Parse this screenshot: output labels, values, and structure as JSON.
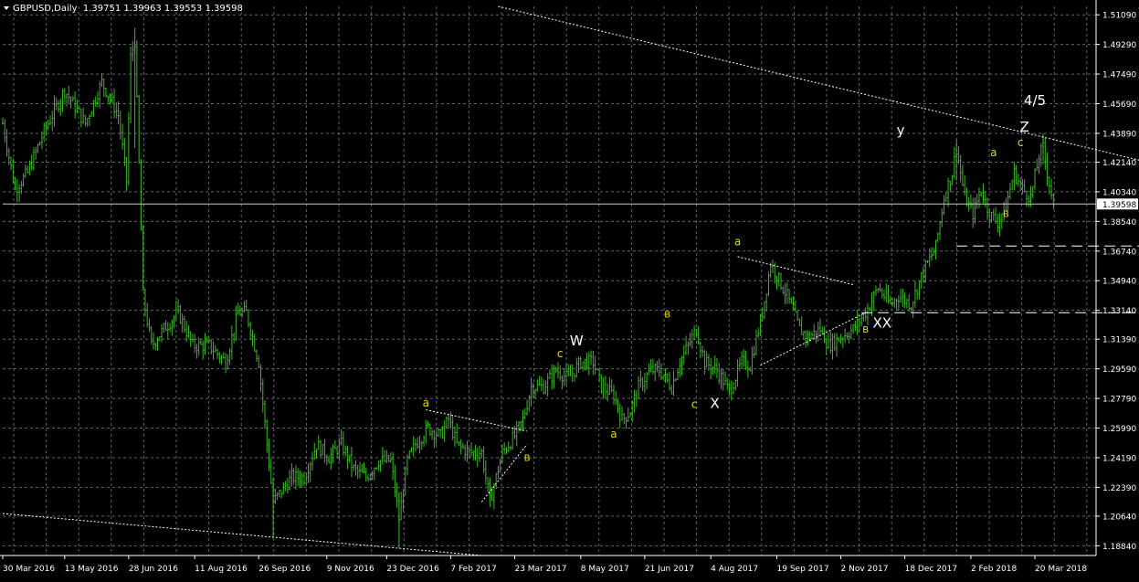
{
  "window": {
    "title": "GBPUSD,Daily",
    "ohlc": "1.39751 1.39963 1.39553 1.39598"
  },
  "colors": {
    "background": "#000000",
    "grid": "#5a6870",
    "bars": "#3fb52a",
    "labels_yellow": "#e8d800",
    "labels_white": "#ffffff",
    "price_line": "#c8c8c8"
  },
  "chart_data": {
    "type": "bar",
    "symbol": "GBPUSD",
    "timeframe": "Daily",
    "current_price": "1.39598",
    "ylim": [
      1.1825,
      1.516
    ],
    "y_ticks": [
      "1.51090",
      "1.49290",
      "1.47490",
      "1.45690",
      "1.43890",
      "1.42140",
      "1.40340",
      "1.38540",
      "1.36740",
      "1.34940",
      "1.33140",
      "1.31390",
      "1.29590",
      "1.27790",
      "1.25990",
      "1.24190",
      "1.22390",
      "1.20640",
      "1.18840"
    ],
    "x_ticks": [
      "30 Mar 2016",
      "13 May 2016",
      "28 Jun 2016",
      "11 Aug 2016",
      "26 Sep 2016",
      "9 Nov 2016",
      "23 Dec 2016",
      "7 Feb 2017",
      "23 Mar 2017",
      "8 May 2017",
      "21 Jun 2017",
      "4 Aug 2017",
      "19 Sep 2017",
      "2 Nov 2017",
      "18 Dec 2017",
      "2 Feb 2018",
      "20 Mar 2018"
    ],
    "x_tick_index": [
      0,
      30,
      61,
      93,
      124,
      157,
      186,
      217,
      248,
      280,
      311,
      343,
      375,
      406,
      437,
      469,
      500
    ],
    "grid": true,
    "price_path": [
      [
        0,
        1.445
      ],
      [
        6,
        1.405
      ],
      [
        12,
        1.415
      ],
      [
        20,
        1.44
      ],
      [
        30,
        1.465
      ],
      [
        40,
        1.445
      ],
      [
        48,
        1.47
      ],
      [
        56,
        1.45
      ],
      [
        60,
        1.41
      ],
      [
        62,
        1.485
      ],
      [
        64,
        1.495
      ],
      [
        66,
        1.42
      ],
      [
        68,
        1.34
      ],
      [
        72,
        1.31
      ],
      [
        78,
        1.32
      ],
      [
        85,
        1.33
      ],
      [
        92,
        1.31
      ],
      [
        100,
        1.31
      ],
      [
        108,
        1.3
      ],
      [
        114,
        1.33
      ],
      [
        118,
        1.33
      ],
      [
        124,
        1.3
      ],
      [
        128,
        1.25
      ],
      [
        131,
        1.215
      ],
      [
        134,
        1.22
      ],
      [
        140,
        1.23
      ],
      [
        146,
        1.23
      ],
      [
        152,
        1.25
      ],
      [
        158,
        1.242
      ],
      [
        164,
        1.25
      ],
      [
        170,
        1.235
      ],
      [
        176,
        1.23
      ],
      [
        182,
        1.24
      ],
      [
        188,
        1.24
      ],
      [
        192,
        1.205
      ],
      [
        196,
        1.24
      ],
      [
        200,
        1.25
      ],
      [
        206,
        1.26
      ],
      [
        212,
        1.255
      ],
      [
        216,
        1.265
      ],
      [
        220,
        1.25
      ],
      [
        226,
        1.245
      ],
      [
        232,
        1.245
      ],
      [
        236,
        1.215
      ],
      [
        242,
        1.245
      ],
      [
        248,
        1.255
      ],
      [
        252,
        1.265
      ],
      [
        256,
        1.285
      ],
      [
        262,
        1.285
      ],
      [
        268,
        1.295
      ],
      [
        274,
        1.29
      ],
      [
        280,
        1.3
      ],
      [
        286,
        1.3
      ],
      [
        290,
        1.285
      ],
      [
        296,
        1.28
      ],
      [
        300,
        1.265
      ],
      [
        304,
        1.27
      ],
      [
        308,
        1.285
      ],
      [
        314,
        1.295
      ],
      [
        318,
        1.295
      ],
      [
        324,
        1.285
      ],
      [
        328,
        1.3
      ],
      [
        332,
        1.31
      ],
      [
        336,
        1.32
      ],
      [
        340,
        1.3
      ],
      [
        346,
        1.295
      ],
      [
        352,
        1.282
      ],
      [
        358,
        1.3
      ],
      [
        362,
        1.298
      ],
      [
        368,
        1.33
      ],
      [
        372,
        1.36
      ],
      [
        376,
        1.35
      ],
      [
        380,
        1.34
      ],
      [
        386,
        1.32
      ],
      [
        390,
        1.315
      ],
      [
        396,
        1.32
      ],
      [
        400,
        1.31
      ],
      [
        406,
        1.315
      ],
      [
        412,
        1.32
      ],
      [
        418,
        1.33
      ],
      [
        424,
        1.345
      ],
      [
        430,
        1.335
      ],
      [
        434,
        1.34
      ],
      [
        440,
        1.335
      ],
      [
        446,
        1.355
      ],
      [
        452,
        1.37
      ],
      [
        456,
        1.4
      ],
      [
        460,
        1.415
      ],
      [
        462,
        1.43
      ],
      [
        466,
        1.4
      ],
      [
        470,
        1.39
      ],
      [
        474,
        1.405
      ],
      [
        478,
        1.39
      ],
      [
        482,
        1.385
      ],
      [
        486,
        1.395
      ],
      [
        490,
        1.415
      ],
      [
        494,
        1.405
      ],
      [
        498,
        1.4
      ],
      [
        502,
        1.425
      ],
      [
        504,
        1.43
      ],
      [
        506,
        1.415
      ],
      [
        509,
        1.396
      ]
    ],
    "annotations": [
      {
        "text": "a",
        "i": 205,
        "p": 1.273,
        "color": "yellow"
      },
      {
        "text": "в",
        "i": 254,
        "p": 1.24,
        "color": "yellow"
      },
      {
        "text": "c",
        "i": 270,
        "p": 1.303,
        "color": "yellow"
      },
      {
        "text": "W",
        "i": 278,
        "p": 1.31,
        "color": "white"
      },
      {
        "text": "в",
        "i": 322,
        "p": 1.327,
        "color": "yellow"
      },
      {
        "text": "a",
        "i": 296,
        "p": 1.254,
        "color": "yellow"
      },
      {
        "text": "c",
        "i": 335,
        "p": 1.272,
        "color": "yellow"
      },
      {
        "text": "X",
        "i": 345,
        "p": 1.272,
        "color": "white"
      },
      {
        "text": "a",
        "i": 356,
        "p": 1.371,
        "color": "yellow"
      },
      {
        "text": "в",
        "i": 418,
        "p": 1.318,
        "color": "yellow"
      },
      {
        "text": "XX",
        "i": 426,
        "p": 1.321,
        "color": "white"
      },
      {
        "text": "y",
        "i": 435,
        "p": 1.438,
        "color": "white"
      },
      {
        "text": "a",
        "i": 480,
        "p": 1.425,
        "color": "yellow"
      },
      {
        "text": "в",
        "i": 486,
        "p": 1.388,
        "color": "yellow"
      },
      {
        "text": "c",
        "i": 493,
        "p": 1.431,
        "color": "yellow"
      },
      {
        "text": "Z",
        "i": 495,
        "p": 1.44,
        "color": "white"
      },
      {
        "text": "4/5",
        "i": 500,
        "p": 1.456,
        "color": "white"
      }
    ],
    "trendlines": [
      {
        "style": "dotted",
        "from": [
          240,
          1.516
        ],
        "to": [
          556,
          1.421
        ]
      },
      {
        "style": "dotted",
        "from": [
          0,
          1.208
        ],
        "to": [
          232,
          1.1825
        ]
      },
      {
        "style": "dotted",
        "from": [
          205,
          1.271
        ],
        "to": [
          254,
          1.258
        ]
      },
      {
        "style": "dotted",
        "from": [
          232,
          1.215
        ],
        "to": [
          254,
          1.25
        ]
      },
      {
        "style": "dotted",
        "from": [
          356,
          1.364
        ],
        "to": [
          412,
          1.347
        ]
      },
      {
        "style": "dotted",
        "from": [
          367,
          1.298
        ],
        "to": [
          418,
          1.33
        ]
      }
    ],
    "levels": [
      {
        "style": "dashed",
        "p": 1.3705,
        "from": 462,
        "to": 556
      },
      {
        "style": "dashed",
        "p": 1.33,
        "from": 416,
        "to": 556
      }
    ]
  }
}
